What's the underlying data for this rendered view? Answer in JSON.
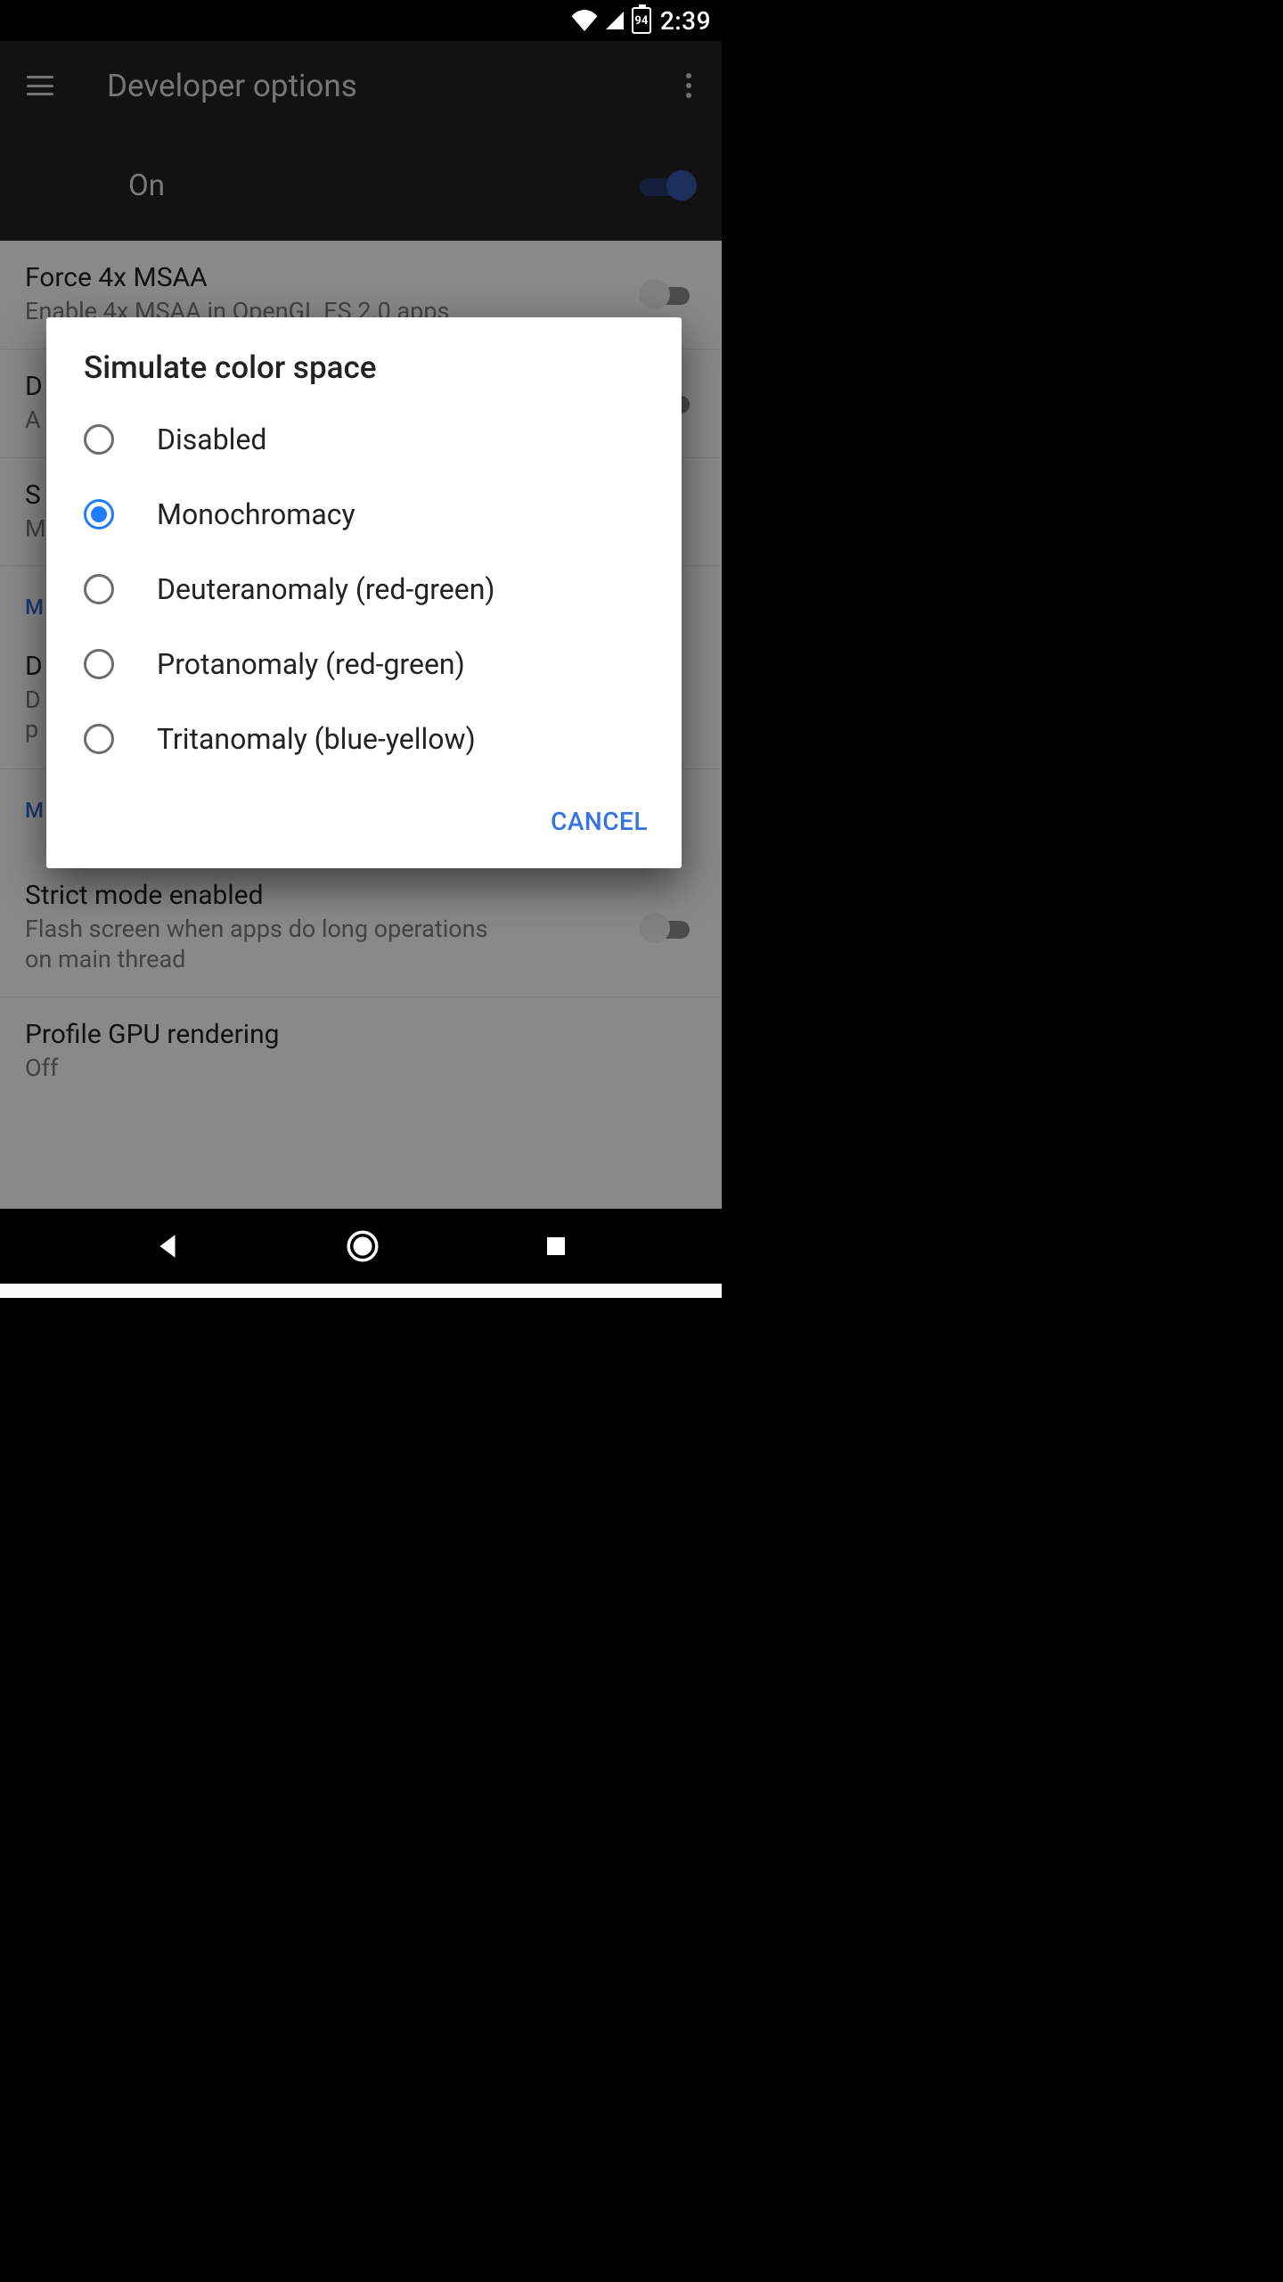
{
  "statusbar": {
    "battery_pct": "94",
    "time": "2:39"
  },
  "header": {
    "title": "Developer options",
    "master_label": "On",
    "master_on": true
  },
  "settings": [
    {
      "title": "Force 4x MSAA",
      "sub": "Enable 4x MSAA in OpenGL ES 2.0 apps",
      "toggle": "off"
    },
    {
      "title": "D",
      "sub": "A",
      "toggle": "off"
    },
    {
      "title": "S",
      "sub": "M"
    }
  ],
  "cat1": "M",
  "item_d": {
    "title": "D",
    "sub": "D\np"
  },
  "cat2": "M",
  "item_strict": {
    "title": "Strict mode enabled",
    "sub": "Flash screen when apps do long operations on main thread"
  },
  "item_profile": {
    "title": "Profile GPU rendering",
    "sub": "Off"
  },
  "dialog": {
    "title": "Simulate color space",
    "options": [
      {
        "label": "Disabled",
        "selected": false
      },
      {
        "label": "Monochromacy",
        "selected": true
      },
      {
        "label": "Deuteranomaly (red-green)",
        "selected": false
      },
      {
        "label": "Protanomaly (red-green)",
        "selected": false
      },
      {
        "label": "Tritanomaly (blue-yellow)",
        "selected": false
      }
    ],
    "cancel": "CANCEL"
  }
}
